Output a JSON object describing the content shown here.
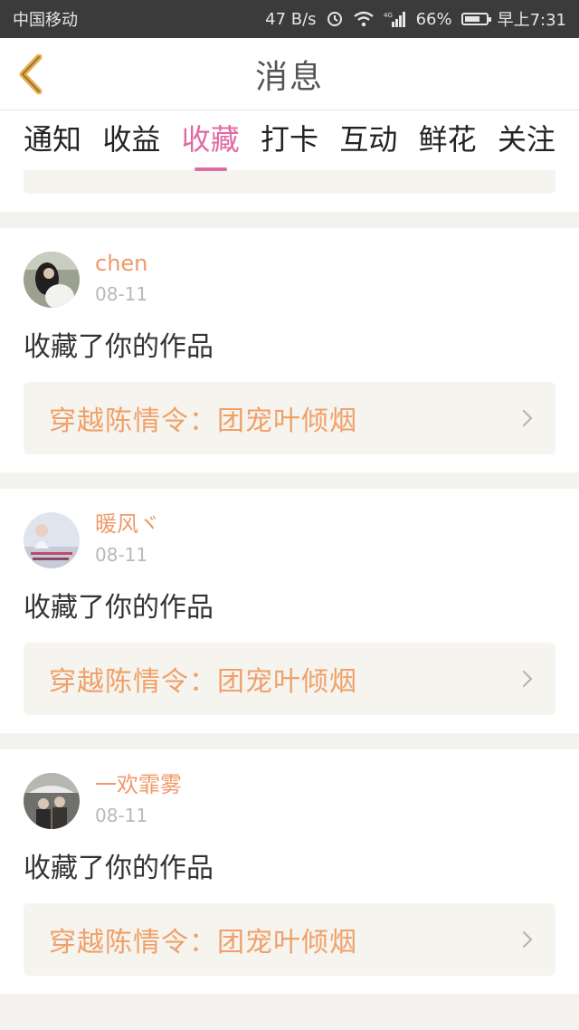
{
  "status_bar": {
    "carrier": "中国移动",
    "speed": "47 B/s",
    "network": "4G",
    "battery": "66%",
    "time": "早上7:31"
  },
  "header": {
    "title": "消息"
  },
  "tabs": [
    {
      "label": "通知"
    },
    {
      "label": "收益"
    },
    {
      "label": "收藏",
      "active": true
    },
    {
      "label": "打卡"
    },
    {
      "label": "互动"
    },
    {
      "label": "鲜花"
    },
    {
      "label": "关注"
    }
  ],
  "messages": [
    {
      "user": "chen",
      "date": "08-11",
      "action": "收藏了你的作品",
      "work": "穿越陈情令：团宠叶倾烟"
    },
    {
      "user": "暖风ヾ",
      "date": "08-11",
      "action": "收藏了你的作品",
      "work": "穿越陈情令：团宠叶倾烟"
    },
    {
      "user": "一欢霏雾",
      "date": "08-11",
      "action": "收藏了你的作品",
      "work": "穿越陈情令：团宠叶倾烟"
    }
  ],
  "colors": {
    "accent": "#e06aa3",
    "username": "#ee9a6a",
    "link_text": "#f0a06a",
    "back_arrow": "#e8b04a"
  }
}
